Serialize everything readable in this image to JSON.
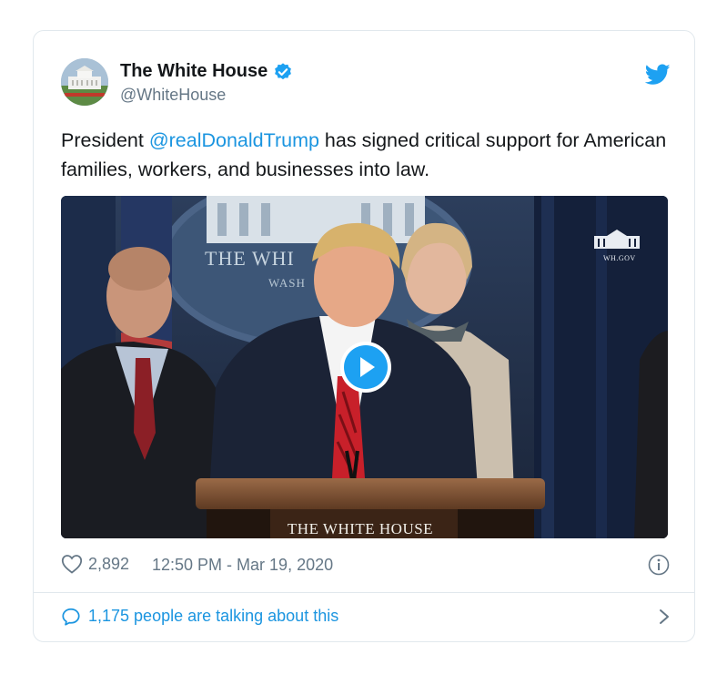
{
  "tweet": {
    "display_name": "The White House",
    "handle": "@WhiteHouse",
    "verified": true,
    "text_before": "President ",
    "mention": "@realDonaldTrump",
    "text_after": " has signed critical support for American families, workers, and businesses into law."
  },
  "media": {
    "type": "video",
    "corner_logo_text": "WH.GOV",
    "podium_text": "THE WHITE HOUSE",
    "seal_text_top": "THE WHI",
    "seal_text_bottom": "WASH",
    "play_icon": "play-icon"
  },
  "meta": {
    "likes": "2,892",
    "timestamp": "12:50 PM - Mar 19, 2020",
    "like_icon": "heart-icon",
    "info_icon": "info-icon"
  },
  "conversation": {
    "label": "1,175 people are talking about this",
    "icon": "speech-bubble-icon",
    "chevron_icon": "chevron-right-icon"
  },
  "colors": {
    "link": "#1b95e0",
    "secondary_text": "#657786",
    "border": "#e1e8ed",
    "twitter_blue": "#1da1f2"
  }
}
